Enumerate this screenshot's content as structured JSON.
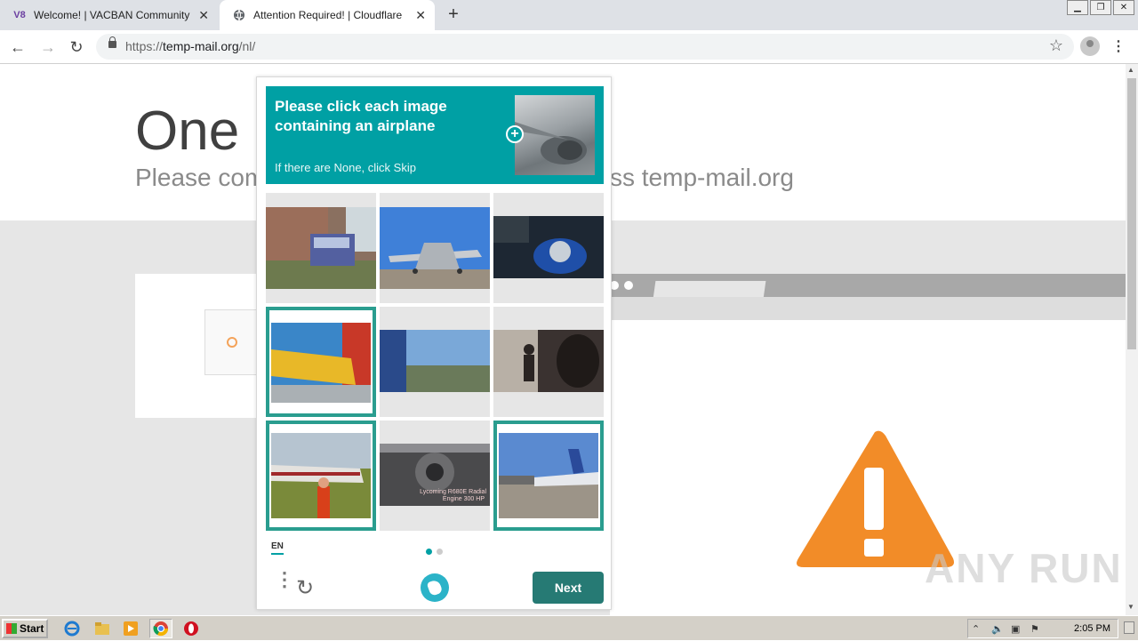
{
  "browser": {
    "tabs": [
      {
        "favicon": "V8",
        "title": "Welcome! | VACBAN Community"
      },
      {
        "favicon": "globe-icon",
        "title": "Attention Required! | Cloudflare"
      }
    ],
    "url_prefix": "https://",
    "url_host": "temp-mail.org",
    "url_path": "/nl/"
  },
  "page": {
    "heading": "One r",
    "subtitle_left": "Please com",
    "subtitle_right": "ss temp-mail.org"
  },
  "captcha": {
    "prompt": "Please click each image containing an airplane",
    "hint": "If there are None, click Skip",
    "tiles": [
      {
        "subject": "bus",
        "selected": false
      },
      {
        "subject": "airplane",
        "selected": false
      },
      {
        "subject": "motorcycle",
        "selected": false
      },
      {
        "subject": "airplane",
        "selected": true
      },
      {
        "subject": "train",
        "selected": false
      },
      {
        "subject": "person",
        "selected": false
      },
      {
        "subject": "airplane",
        "selected": true
      },
      {
        "subject": "engine",
        "selected": false
      },
      {
        "subject": "airplane",
        "selected": true
      }
    ],
    "engine_caption_1": "Lycoming R680E Radial",
    "engine_caption_2": "Engine 300 HP",
    "language": "EN",
    "page_index": 1,
    "page_count": 2,
    "next_label": "Next"
  },
  "watermark": "ANY RUN",
  "taskbar": {
    "start_label": "Start",
    "clock": "2:05 PM"
  },
  "colors": {
    "captcha_accent": "#00a0a4",
    "next_button": "#267a74",
    "selection_border": "#2a9d8f",
    "warning": "#f28c28"
  }
}
